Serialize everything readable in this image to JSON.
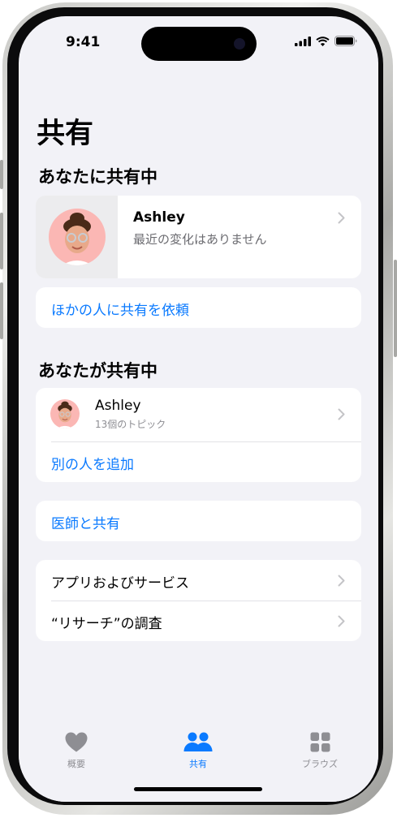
{
  "status_bar": {
    "time": "9:41"
  },
  "page": {
    "title": "共有"
  },
  "sharing_with_you": {
    "header": "あなたに共有中",
    "person": {
      "name": "Ashley",
      "subtitle": "最近の変化はありません"
    },
    "request_link": "ほかの人に共有を依頼"
  },
  "you_are_sharing": {
    "header": "あなたが共有中",
    "person": {
      "name": "Ashley",
      "subtitle": "13個のトピック"
    },
    "add_link": "別の人を追加"
  },
  "doctor": {
    "link": "医師と共有"
  },
  "more": {
    "items": [
      {
        "label": "アプリおよびサービス"
      },
      {
        "label": "“リサーチ”の調査"
      }
    ]
  },
  "tab_bar": {
    "tabs": [
      {
        "label": "概要",
        "icon": "heart-icon",
        "active": false
      },
      {
        "label": "共有",
        "icon": "people-icon",
        "active": true
      },
      {
        "label": "ブラウズ",
        "icon": "grid-icon",
        "active": false
      }
    ]
  },
  "colors": {
    "accent": "#0a7aff",
    "background": "#f2f2f7",
    "inactive": "#8e8e93"
  }
}
